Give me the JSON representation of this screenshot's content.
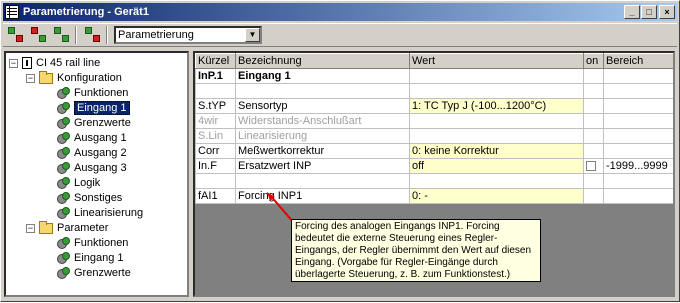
{
  "window": {
    "title": "Parametrierung - Gerät1",
    "minimize_icon": "minimize-icon",
    "maximize_icon": "maximize-icon",
    "close_icon": "close-icon"
  },
  "toolbar": {
    "combo_value": "Parametrierung",
    "tool_icons": [
      "send-to-device-icon",
      "read-from-device-icon",
      "compare-icon",
      "settings-icon"
    ]
  },
  "tree": {
    "items": [
      {
        "label": "CI 45 rail line",
        "icon": "device-icon",
        "level": 0,
        "expander": "−"
      },
      {
        "label": "Konfiguration",
        "icon": "folder-icon",
        "level": 1,
        "expander": "−"
      },
      {
        "label": "Funktionen",
        "icon": "gear-icon",
        "level": 2
      },
      {
        "label": "Eingang 1",
        "icon": "gear-icon",
        "level": 2,
        "selected": true
      },
      {
        "label": "Grenzwerte",
        "icon": "gear-icon",
        "level": 2
      },
      {
        "label": "Ausgang 1",
        "icon": "gear-icon",
        "level": 2
      },
      {
        "label": "Ausgang 2",
        "icon": "gear-icon",
        "level": 2
      },
      {
        "label": "Ausgang 3",
        "icon": "gear-icon",
        "level": 2
      },
      {
        "label": "Logik",
        "icon": "gear-icon",
        "level": 2
      },
      {
        "label": "Sonstiges",
        "icon": "gear-icon",
        "level": 2
      },
      {
        "label": "Linearisierung",
        "icon": "gear-icon",
        "level": 2
      },
      {
        "label": "Parameter",
        "icon": "folder-icon",
        "level": 1,
        "expander": "−"
      },
      {
        "label": "Funktionen",
        "icon": "gear-icon",
        "level": 2
      },
      {
        "label": "Eingang 1",
        "icon": "gear-icon",
        "level": 2
      },
      {
        "label": "Grenzwerte",
        "icon": "gear-icon",
        "level": 2
      }
    ]
  },
  "grid": {
    "headers": [
      "Kürzel",
      "Bezeichnung",
      "Wert",
      "on",
      "Bereich"
    ],
    "rows": [
      {
        "kuerzel": "InP.1",
        "bez": "Eingang 1",
        "wert": "",
        "bereich": "",
        "style": "bold"
      },
      {
        "kuerzel": "",
        "bez": "",
        "wert": "",
        "bereich": "",
        "style": "blank"
      },
      {
        "kuerzel": "S.tYP",
        "bez": "Sensortyp",
        "wert": "1: TC Typ J (-100...1200°C)",
        "bereich": "",
        "style": "yellow"
      },
      {
        "kuerzel": "4wir",
        "bez": "Widerstands-Anschlußart",
        "wert": "",
        "bereich": "",
        "style": "disabled"
      },
      {
        "kuerzel": "S.Lin",
        "bez": "Linearisierung",
        "wert": "",
        "bereich": "",
        "style": "disabled"
      },
      {
        "kuerzel": "Corr",
        "bez": "Meßwertkorrektur",
        "wert": "0: keine Korrektur",
        "bereich": "",
        "style": "yellow"
      },
      {
        "kuerzel": "In.F",
        "bez": "Ersatzwert INP",
        "wert": "off",
        "bereich": "-1999...9999",
        "style": "yellow-check"
      },
      {
        "kuerzel": "",
        "bez": "",
        "wert": "",
        "bereich": "",
        "style": "blank"
      },
      {
        "kuerzel": "fAI1",
        "bez": "Forcing INP1",
        "wert": "0: -",
        "bereich": "",
        "style": "yellow"
      }
    ]
  },
  "tooltip": {
    "text": "Forcing des analogen Eingangs INP1. Forcing bedeutet die externe Steuerung eines Regler-Eingangs, der Regler übernimmt den Wert auf diesen Eingang. (Vorgabe für Regler-Eingänge durch überlagerte Steuerung, z. B. zum Funktionstest.)"
  },
  "colors": {
    "title_start": "#0a246a",
    "title_end": "#a6caf0",
    "value_bg": "#ffffcc",
    "tooltip_bg": "#ffffe1",
    "arrow": "#e00000"
  }
}
